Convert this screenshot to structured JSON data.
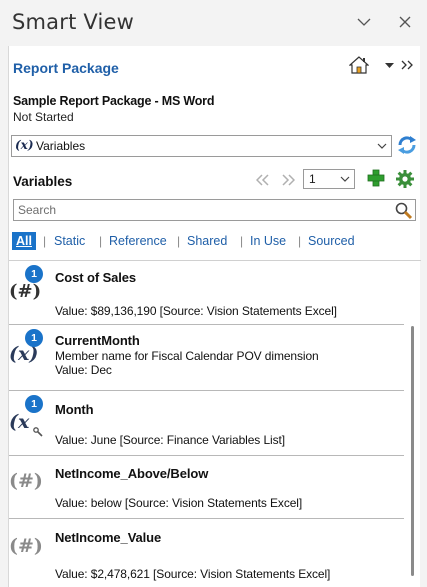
{
  "window": {
    "title": "Smart View",
    "minimize_glyph": "∨",
    "close_glyph": "×"
  },
  "report_package": {
    "link_label": "Report Package",
    "icons": [
      "home-icon",
      "dropdown-arrow-icon",
      "double-chevron-right-icon"
    ],
    "name": "Sample Report Package - MS Word",
    "status": "Not Started"
  },
  "selector": {
    "prefix": "(x)",
    "value": "Variables",
    "icon": "refresh-icon"
  },
  "variables_section": {
    "title": "Variables",
    "page": "1",
    "icons": [
      "previous-icon",
      "next-icon",
      "add-icon",
      "settings-icon"
    ]
  },
  "search": {
    "placeholder": "Search"
  },
  "filters": [
    {
      "label": "All",
      "active": true
    },
    {
      "label": "Static",
      "active": false
    },
    {
      "label": "Reference",
      "active": false
    },
    {
      "label": "Shared",
      "active": false
    },
    {
      "label": "In Use",
      "active": false
    },
    {
      "label": "Sourced",
      "active": false
    }
  ],
  "variables": [
    {
      "name": "Cost of Sales",
      "icon": "(#)",
      "badge": "1",
      "lines": [
        "Value:  $89,136,190  [Source: Vision Statements Excel]"
      ]
    },
    {
      "name": "CurrentMonth",
      "icon": "(x)",
      "badge": "1",
      "lines": [
        "Member name for Fiscal Calendar POV dimension",
        "Value: Dec"
      ]
    },
    {
      "name": "Month",
      "icon": "(x",
      "badge": "1",
      "lines": [
        "Value: June [Source: Finance Variables List]"
      ]
    },
    {
      "name": "NetIncome_Above/Below",
      "icon": "(#)",
      "badge": "",
      "lines": [
        "Value: below [Source: Vision Statements Excel]"
      ]
    },
    {
      "name": "NetIncome_Value",
      "icon": "(#)",
      "badge": "",
      "lines": [
        "Value:  $2,478,621  [Source: Vision Statements Excel]"
      ]
    }
  ],
  "colors": {
    "link": "#1f5fa8",
    "accent": "#1a73c9",
    "add_green": "#2e9e2e",
    "settings_green": "#3a8f3a",
    "refresh_blue": "#2f7fd0"
  }
}
